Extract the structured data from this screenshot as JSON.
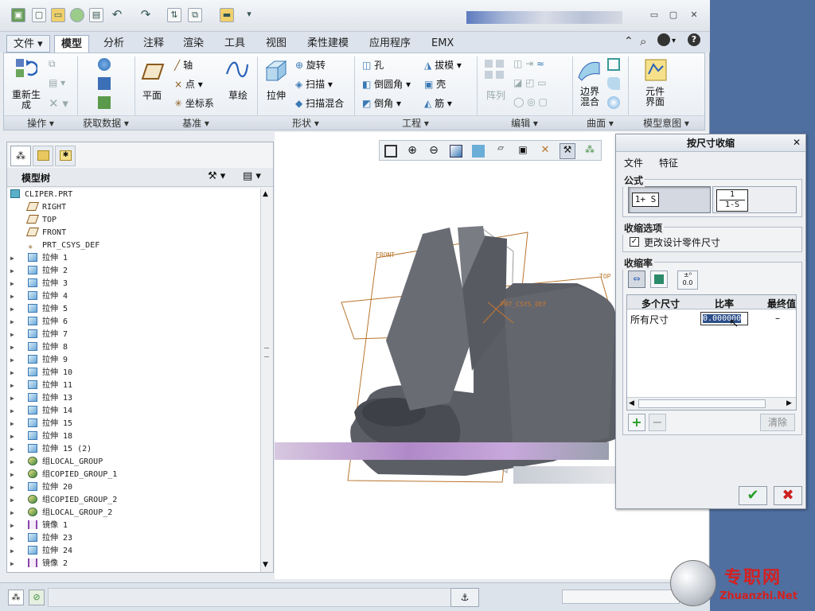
{
  "ribbon": {
    "tabs": [
      "文件",
      "模型",
      "分析",
      "注释",
      "渲染",
      "工具",
      "视图",
      "柔性建模",
      "应用程序",
      "EMX"
    ],
    "active_tab": "模型",
    "groups": [
      "操作",
      "获取数据",
      "基准",
      "形状",
      "工程",
      "编辑",
      "曲面",
      "模型意图"
    ],
    "buttons": {
      "regenerate": "重新生\n成",
      "axis": "轴",
      "point": "点",
      "csys": "坐标系",
      "plane": "平面",
      "sketch": "草绘",
      "extrude": "拉伸",
      "revolve": "旋转",
      "sweep": "扫描",
      "swept_blend": "扫描混合",
      "hole": "孔",
      "round": "倒圆角",
      "chamfer": "倒角",
      "draft": "拔模",
      "shell": "壳",
      "rib": "筋",
      "pattern": "阵列",
      "boundary_blend": "边界\n混合",
      "component_interface": "元件\n界面"
    }
  },
  "model_tree": {
    "title": "模型树",
    "items": [
      {
        "label": "CLIPER.PRT",
        "icon": "part-icon",
        "expand": false,
        "indent": 0
      },
      {
        "label": "RIGHT",
        "icon": "datum-plane-icon",
        "expand": false,
        "indent": 1
      },
      {
        "label": "TOP",
        "icon": "datum-plane-icon",
        "expand": false,
        "indent": 1
      },
      {
        "label": "FRONT",
        "icon": "datum-plane-icon",
        "expand": false,
        "indent": 1
      },
      {
        "label": "PRT_CSYS_DEF",
        "icon": "csys-icon",
        "expand": false,
        "indent": 1
      },
      {
        "label": "拉伸 1",
        "icon": "extrude-icon",
        "expand": true,
        "indent": 1
      },
      {
        "label": "拉伸 2",
        "icon": "extrude-icon",
        "expand": true,
        "indent": 1
      },
      {
        "label": "拉伸 3",
        "icon": "extrude-icon",
        "expand": true,
        "indent": 1
      },
      {
        "label": "拉伸 4",
        "icon": "extrude-icon",
        "expand": true,
        "indent": 1
      },
      {
        "label": "拉伸 5",
        "icon": "extrude-icon",
        "expand": true,
        "indent": 1
      },
      {
        "label": "拉伸 6",
        "icon": "extrude-icon",
        "expand": true,
        "indent": 1
      },
      {
        "label": "拉伸 7",
        "icon": "extrude-icon",
        "expand": true,
        "indent": 1
      },
      {
        "label": "拉伸 8",
        "icon": "extrude-icon",
        "expand": true,
        "indent": 1
      },
      {
        "label": "拉伸 9",
        "icon": "extrude-icon",
        "expand": true,
        "indent": 1
      },
      {
        "label": "拉伸 10",
        "icon": "extrude-icon",
        "expand": true,
        "indent": 1
      },
      {
        "label": "拉伸 11",
        "icon": "extrude-icon",
        "expand": true,
        "indent": 1
      },
      {
        "label": "拉伸 13",
        "icon": "extrude-icon",
        "expand": true,
        "indent": 1
      },
      {
        "label": "拉伸 14",
        "icon": "extrude-icon",
        "expand": true,
        "indent": 1
      },
      {
        "label": "拉伸 15",
        "icon": "extrude-icon",
        "expand": true,
        "indent": 1
      },
      {
        "label": "拉伸 18",
        "icon": "extrude-icon",
        "expand": true,
        "indent": 1
      },
      {
        "label": "拉伸 15 (2)",
        "icon": "extrude-icon",
        "expand": true,
        "indent": 1
      },
      {
        "label": "组LOCAL_GROUP",
        "icon": "group-icon",
        "expand": true,
        "indent": 1
      },
      {
        "label": "组COPIED_GROUP_1",
        "icon": "group-icon",
        "expand": true,
        "indent": 1
      },
      {
        "label": "拉伸 20",
        "icon": "extrude-icon",
        "expand": true,
        "indent": 1
      },
      {
        "label": "组COPIED_GROUP_2",
        "icon": "group-icon",
        "expand": true,
        "indent": 1
      },
      {
        "label": "组LOCAL_GROUP_2",
        "icon": "group-icon",
        "expand": true,
        "indent": 1
      },
      {
        "label": "镜像 1",
        "icon": "mirror-icon",
        "expand": true,
        "indent": 1
      },
      {
        "label": "拉伸 23",
        "icon": "extrude-icon",
        "expand": true,
        "indent": 1
      },
      {
        "label": "拉伸 24",
        "icon": "extrude-icon",
        "expand": true,
        "indent": 1
      },
      {
        "label": "镜像 2",
        "icon": "mirror-icon",
        "expand": true,
        "indent": 1
      }
    ]
  },
  "viewport": {
    "datum_labels": {
      "front": "FRONT",
      "top": "TOP",
      "csys": "PRT_CSYS_DEF"
    }
  },
  "dialog": {
    "title": "按尺寸收缩",
    "menu": [
      "文件",
      "特征"
    ],
    "formula_section": "公式",
    "formula_a": "1+ S",
    "formula_b_num": "1",
    "formula_b_den": "1-S",
    "options_section": "收缩选项",
    "change_design_dims": "更改设计零件尺寸",
    "change_design_dims_checked": true,
    "rate_section": "收缩率",
    "columns": [
      "多个尺寸",
      "比率",
      "最终值"
    ],
    "row": {
      "name": "所有尺寸",
      "ratio": "0.000000",
      "final": "–"
    },
    "clear_button": "清除",
    "accent_ok": "#2a9d2a",
    "accent_cancel": "#cc2222"
  },
  "watermark": {
    "cn": "专职网",
    "url": "Zhuanzhi.Net"
  }
}
